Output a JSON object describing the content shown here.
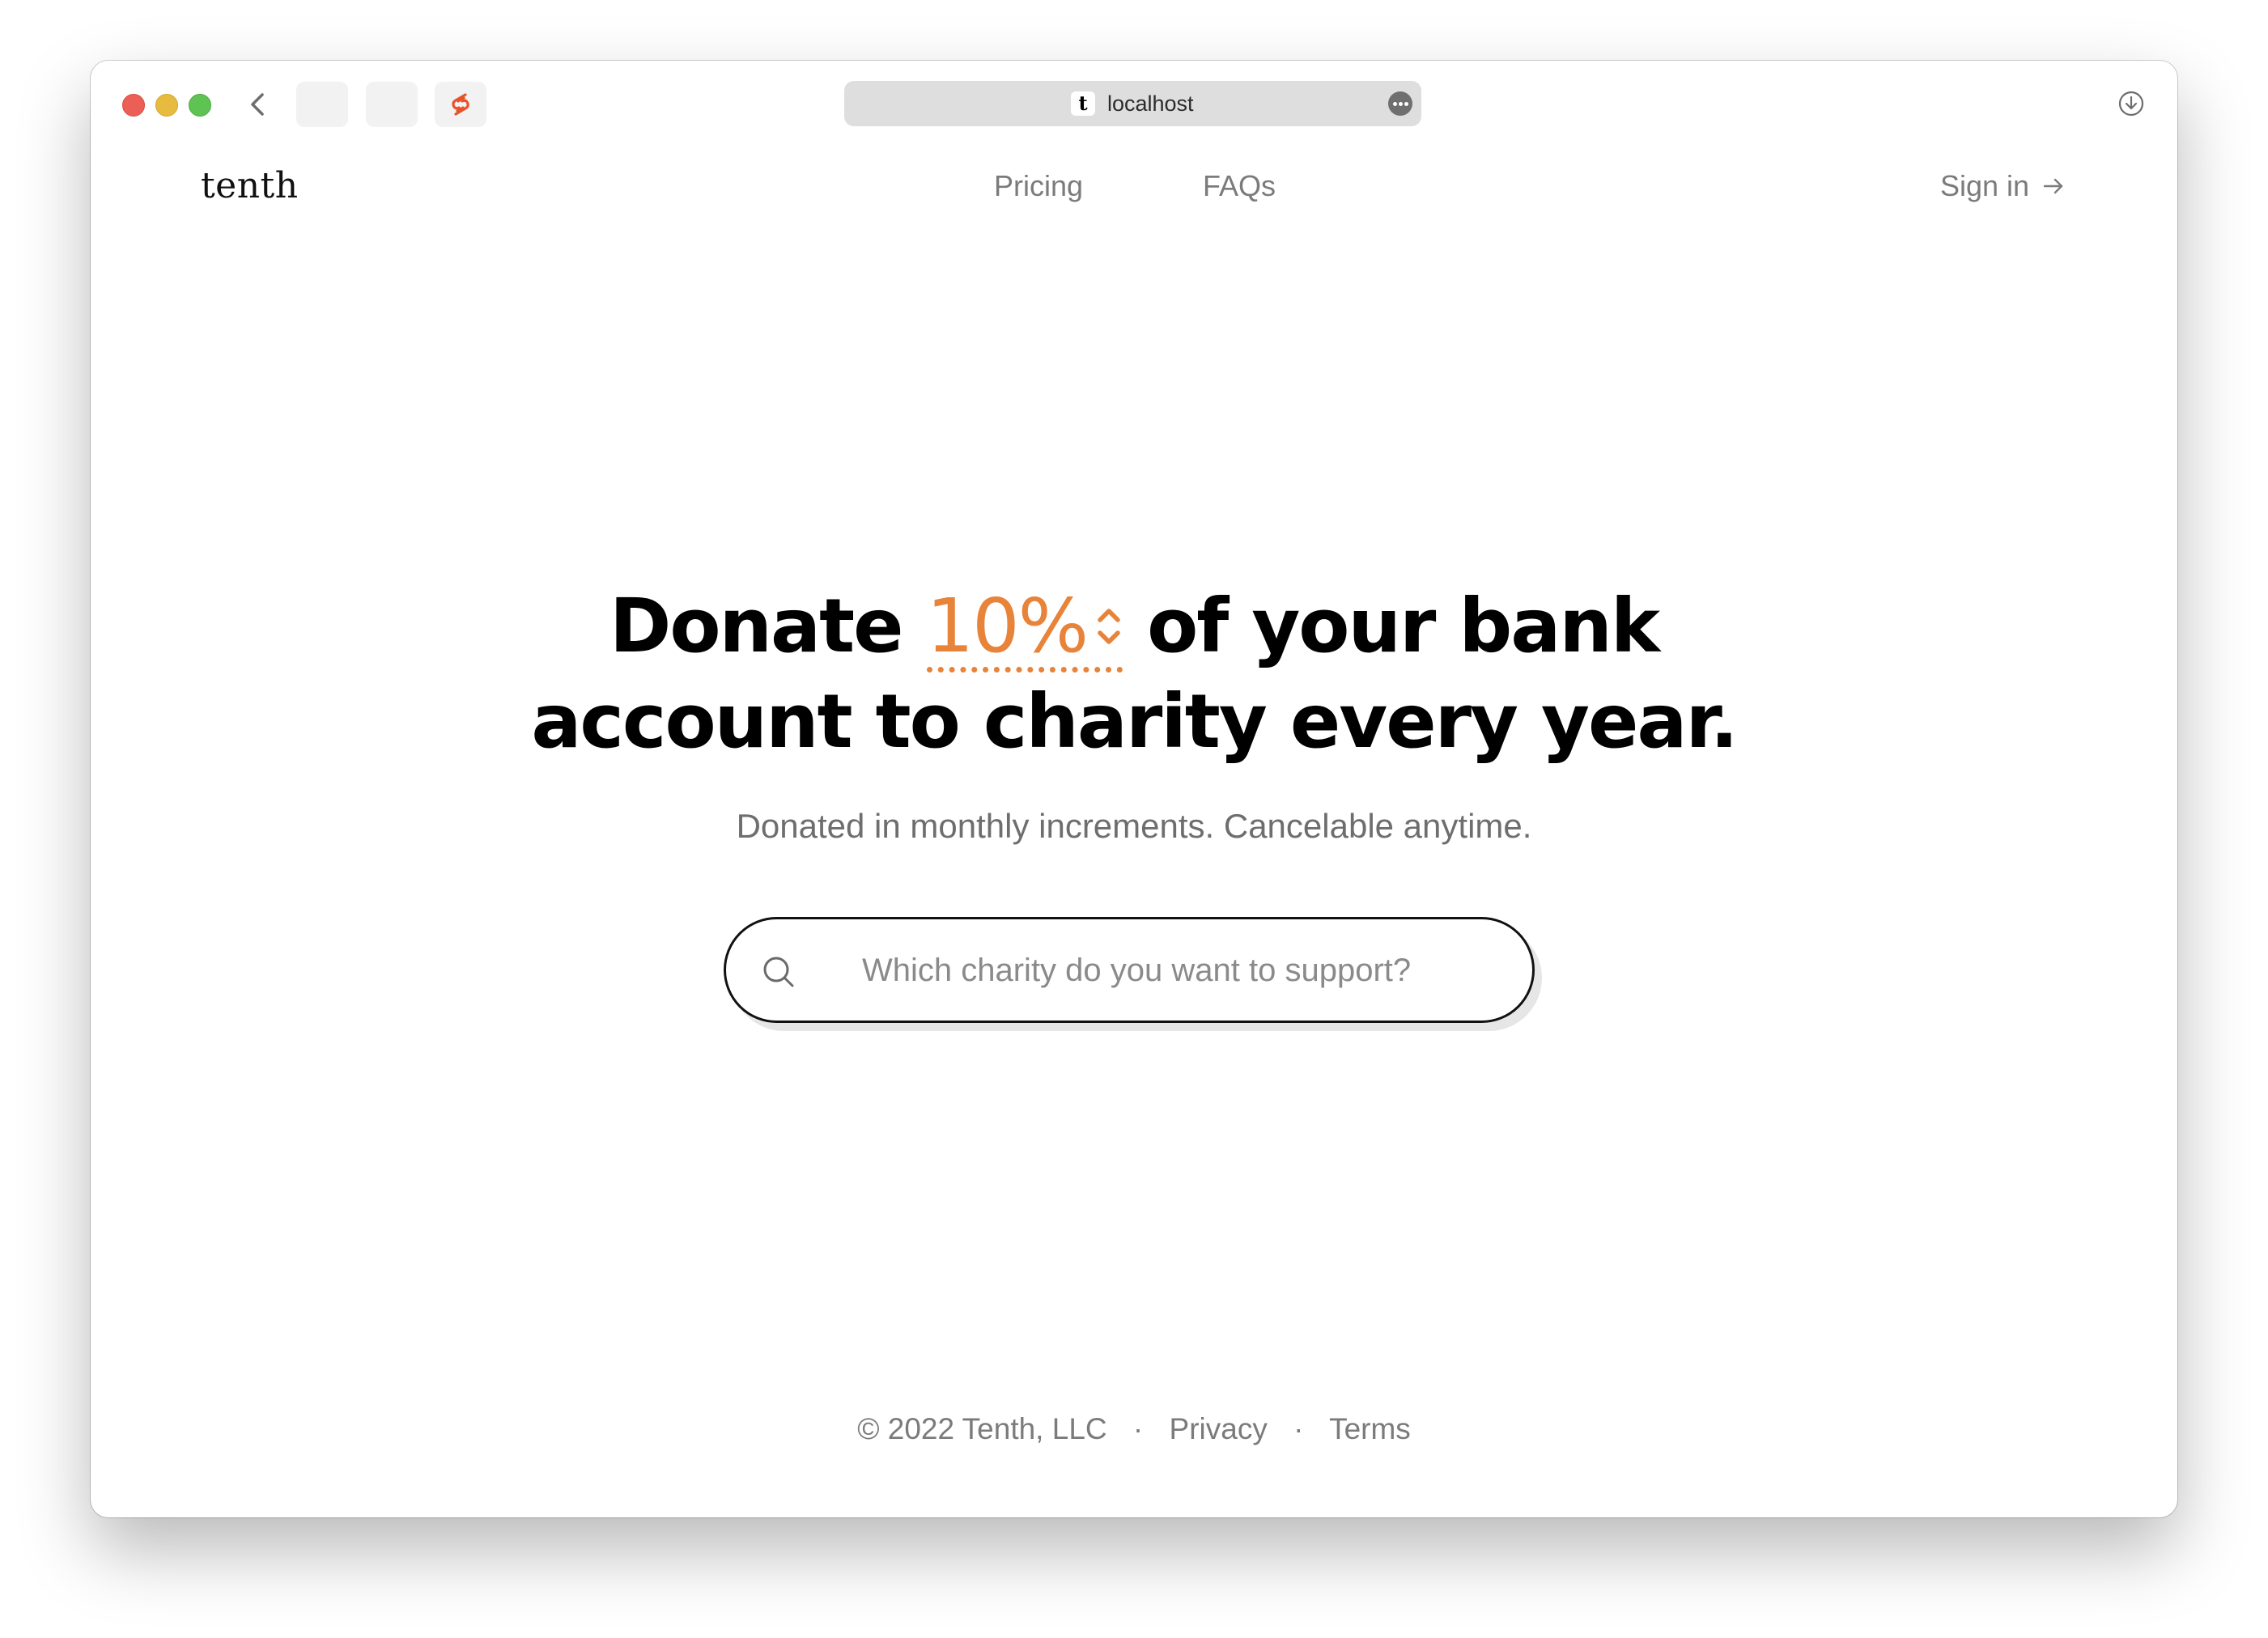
{
  "browser": {
    "url": "localhost",
    "favicon_letter": "t"
  },
  "header": {
    "logo": "tenth",
    "nav": [
      {
        "label": "Pricing"
      },
      {
        "label": "FAQs"
      }
    ],
    "signin_label": "Sign in"
  },
  "hero": {
    "headline_before": "Donate",
    "percent": "10%",
    "headline_after_line1": "of your bank",
    "headline_line2": "account to charity every year.",
    "subtitle": "Donated in monthly increments. Cancelable anytime."
  },
  "search": {
    "placeholder": "Which charity do you want to support?"
  },
  "footer": {
    "copyright": "© 2022 Tenth, LLC",
    "separator": "·",
    "links": [
      {
        "label": "Privacy"
      },
      {
        "label": "Terms"
      }
    ]
  },
  "colors": {
    "accent": "#e8833a",
    "text": "#000000",
    "muted": "#7b7b7b"
  }
}
